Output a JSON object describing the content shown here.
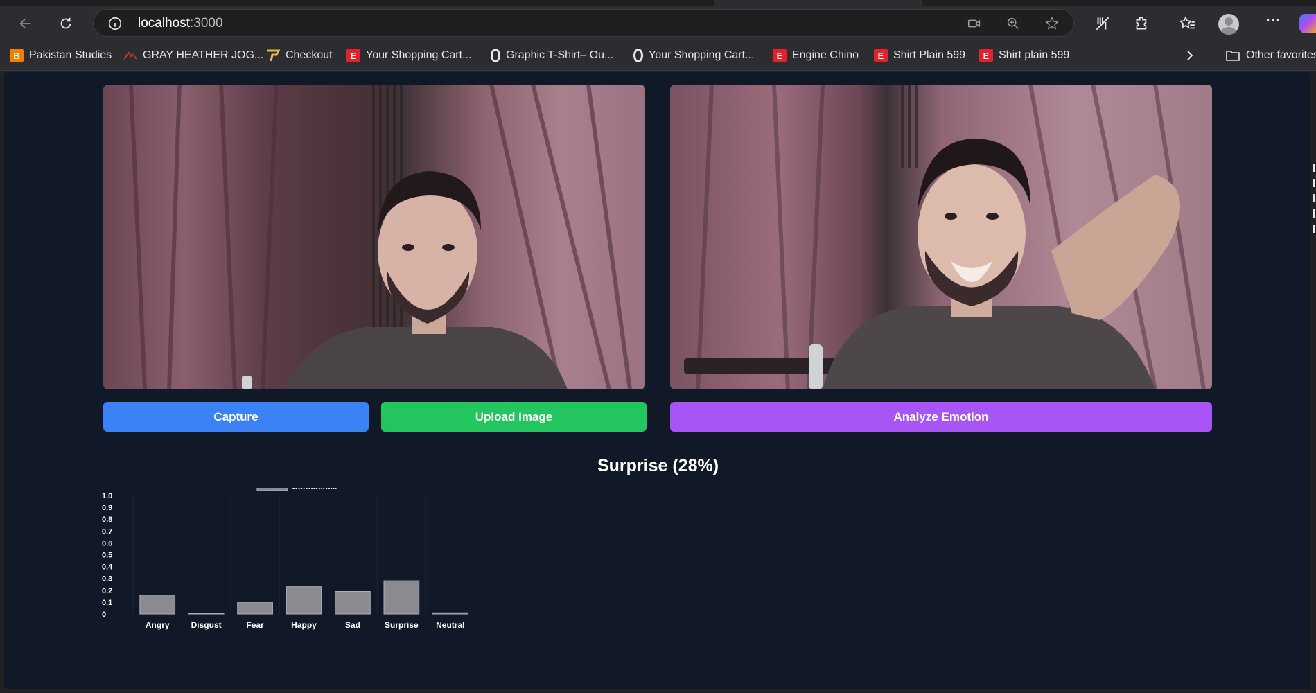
{
  "browser": {
    "url_host": "localhost",
    "url_port": ":3000",
    "bookmarks": [
      {
        "label": "Pakistan Studies",
        "icon": "blogger-icon"
      },
      {
        "label": "GRAY HEATHER JOG...",
        "icon": "brand-icon"
      },
      {
        "label": "Checkout",
        "icon": "checkout-icon"
      },
      {
        "label": "Your Shopping Cart...",
        "icon": "e-icon"
      },
      {
        "label": "Graphic T-Shirt– Ou...",
        "icon": "ring-icon"
      },
      {
        "label": "Your Shopping Cart...",
        "icon": "ring-icon"
      },
      {
        "label": "Engine Chino",
        "icon": "e-icon"
      },
      {
        "label": "Shirt Plain 599",
        "icon": "e-icon"
      },
      {
        "label": "Shirt plain 599",
        "icon": "e-icon"
      }
    ],
    "other_favorites": "Other favorites",
    "e_glyph": "E"
  },
  "app": {
    "capture_label": "Capture",
    "upload_label": "Upload Image",
    "analyze_label": "Analyze Emotion",
    "result_text": "Surprise (28%)",
    "colors": {
      "capture": "#3b82f6",
      "upload": "#22c55e",
      "analyze": "#a855f7",
      "background": "#111827"
    }
  },
  "chart_data": {
    "type": "bar",
    "categories": [
      "Angry",
      "Disgust",
      "Fear",
      "Happy",
      "Sad",
      "Surprise",
      "Neutral"
    ],
    "series": [
      {
        "name": "Confidence",
        "values": [
          0.16,
          0.0,
          0.1,
          0.23,
          0.19,
          0.28,
          0.01
        ]
      }
    ],
    "ylim": [
      0,
      1.0
    ],
    "yticks": [
      "0",
      "0.1",
      "0.2",
      "0.3",
      "0.4",
      "0.5",
      "0.6",
      "0.7",
      "0.8",
      "0.9",
      "1.0"
    ],
    "legend": "top-center",
    "grid": true,
    "bar_color": "#8a8b90"
  }
}
